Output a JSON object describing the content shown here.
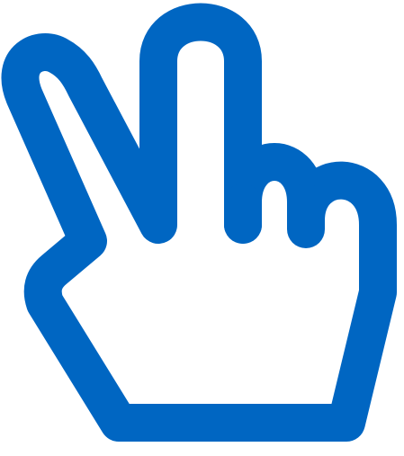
{
  "icon": {
    "name": "victory-hand-icon",
    "stroke_color": "#0066C2",
    "fill_color": "#FFFFFF",
    "background": "#FFFFFF"
  }
}
